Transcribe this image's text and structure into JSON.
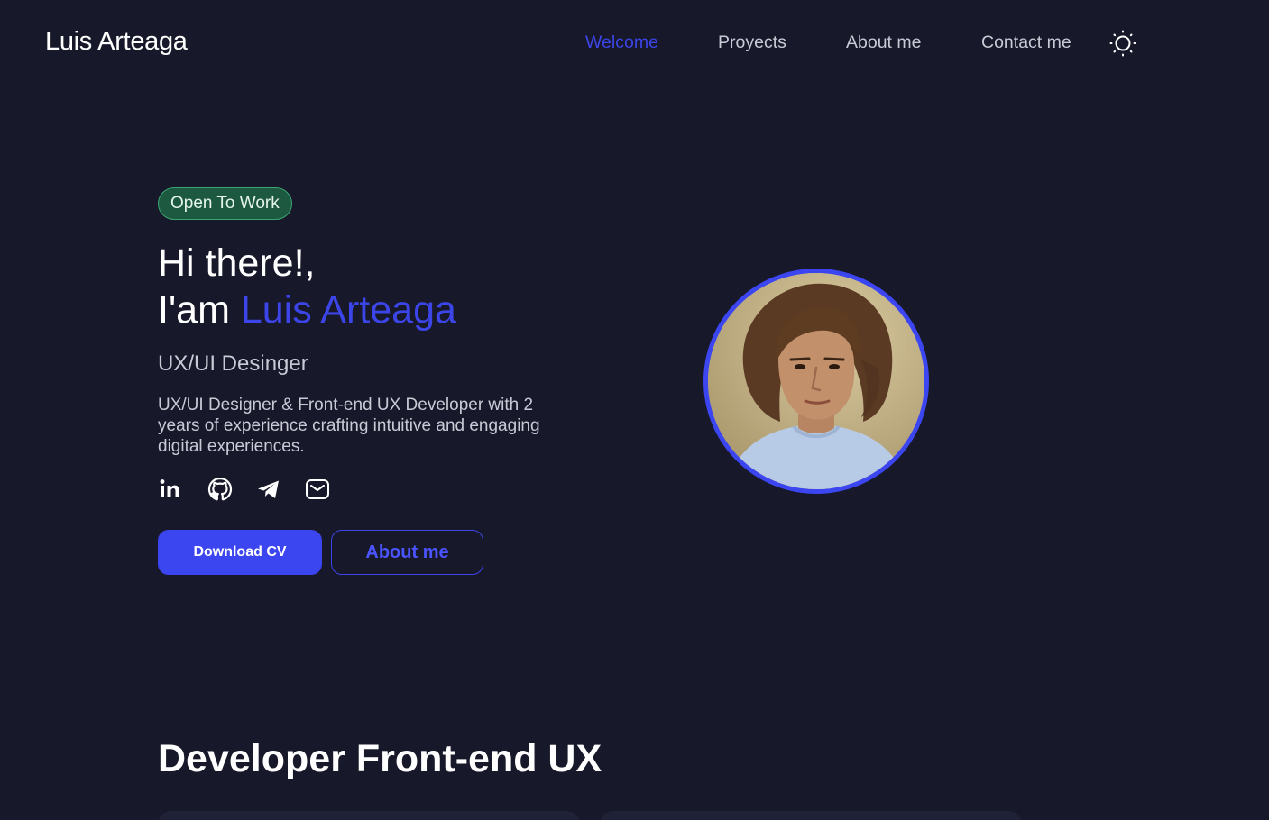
{
  "brand": {
    "name": "Luis Arteaga"
  },
  "nav": {
    "items": [
      {
        "label": "Welcome",
        "active": true
      },
      {
        "label": "Proyects",
        "active": false
      },
      {
        "label": "About me",
        "active": false
      },
      {
        "label": "Contact me",
        "active": false
      }
    ],
    "theme_toggle_icon": "sun-icon"
  },
  "hero": {
    "badge": "Open To Work",
    "greeting": "Hi there!,",
    "intro_prefix": "I'am ",
    "intro_name": "Luis Arteaga",
    "role": "UX/UI Desinger",
    "bio": "UX/UI Designer & Front-end UX Developer with 2 years of experience crafting intuitive and engaging digital experiences.",
    "socials": [
      "linkedin-icon",
      "github-icon",
      "telegram-icon",
      "mail-icon"
    ],
    "primary_button": "Download CV",
    "secondary_button": "About me"
  },
  "section": {
    "title": "Developer Front-end UX"
  },
  "colors": {
    "background": "#171829",
    "accent": "#3b45e8",
    "badge_bg": "#1d5941",
    "badge_border": "#3ba573",
    "muted_text": "#c9cad6"
  }
}
